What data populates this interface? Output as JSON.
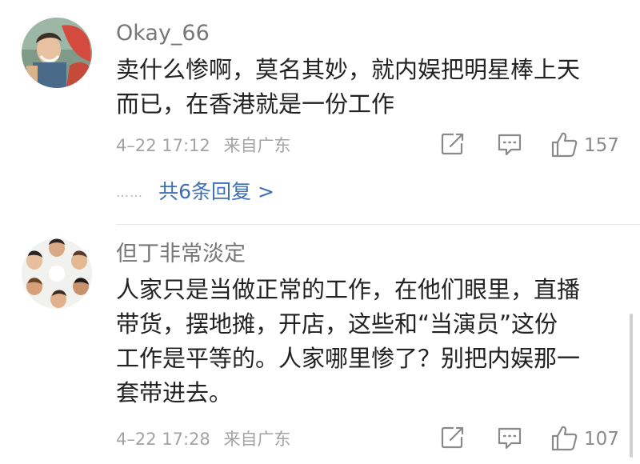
{
  "comments": [
    {
      "username": "Okay_66",
      "text_lines": [
        "卖什么惨啊，莫名其妙，就内娱把明星棒上天",
        "而已，在香港就是一份工作"
      ],
      "date": "4–22 17:12",
      "source": "来自广东",
      "likes": "157",
      "avatar_icon": "user-avatar-photo"
    },
    {
      "username": "但丁非常淡定",
      "text_lines": [
        "人家只是当做正常的工作，在他们眼里，直播",
        "带货，摆地摊，开店，这些和“当演员”这份",
        "工作是平等的。人家哪里惨了？别把内娱那一",
        "套带进去。"
      ],
      "date": "4–22 17:28",
      "source": "来自广东",
      "likes": "107",
      "avatar_icon": "group-avatar-photo"
    }
  ],
  "replies": {
    "dots": "……",
    "link_label": "共6条回复 >"
  },
  "icons": {
    "share": "share-edit-icon",
    "comment": "comment-bubble-icon",
    "like": "thumbs-up-icon"
  },
  "colors": {
    "username": "#777777",
    "meta": "#a3a3a3",
    "link": "#3d6fb6",
    "text": "#222222"
  }
}
